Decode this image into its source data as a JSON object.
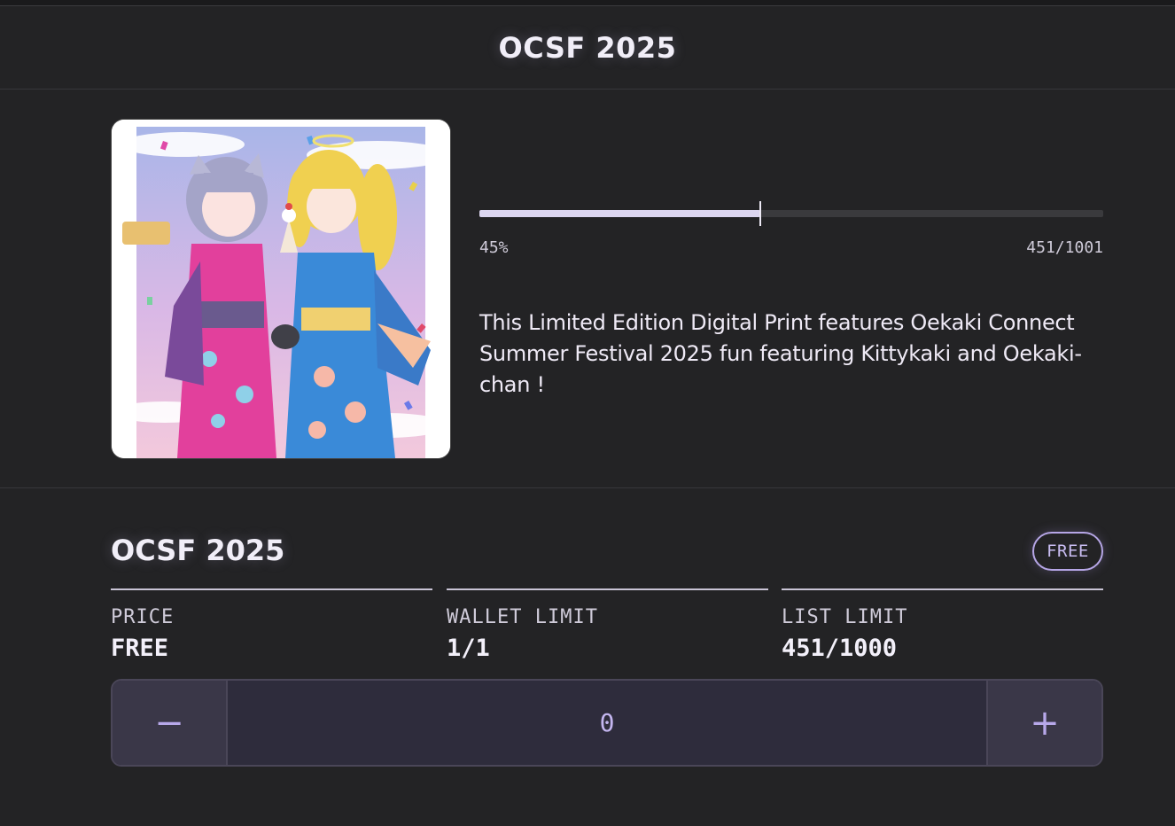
{
  "header": {
    "title": "OCSF 2025"
  },
  "hero": {
    "image_alt": "Oekaki Connect Summer Festival 2025 artwork with Kittykaki and Oekaki-chan",
    "progress": {
      "percent_label": "45%",
      "fraction": 0.45,
      "count_label": "451/1001"
    },
    "description": "This Limited Edition Digital Print features Oekaki Connect Summer Festival 2025 fun featuring Kittykaki and Oekaki-chan !"
  },
  "mint": {
    "title": "OCSF 2025",
    "badge": "FREE",
    "stats": [
      {
        "label": "PRICE",
        "value": "FREE"
      },
      {
        "label": "WALLET LIMIT",
        "value": "1/1"
      },
      {
        "label": "LIST LIMIT",
        "value": "451/1000"
      }
    ],
    "stepper": {
      "minus": "−",
      "value": "0",
      "plus": "+"
    }
  },
  "colors": {
    "background": "#232325",
    "accent": "#b6a6e6",
    "progress_fill": "#dcd6f0"
  }
}
